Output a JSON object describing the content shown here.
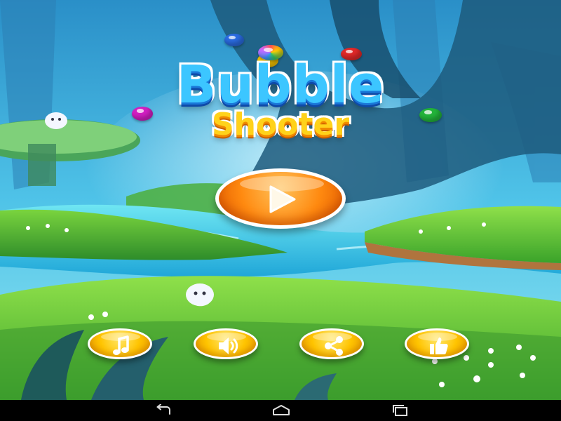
{
  "game": {
    "title_main": "Bubble",
    "title_sub": "Shooter"
  },
  "buttons": {
    "play": {
      "icon": "play-icon"
    },
    "music": {
      "icon": "music-note-icon"
    },
    "sound": {
      "icon": "speaker-icon"
    },
    "share": {
      "icon": "share-icon"
    },
    "like": {
      "icon": "thumbs-up-icon"
    }
  },
  "navigation_bar": {
    "back": {
      "icon": "back-icon"
    },
    "home": {
      "icon": "home-icon"
    },
    "recents": {
      "icon": "recent-apps-icon"
    }
  },
  "colors": {
    "title_blue": "#3cc6ff",
    "title_yellow": "#ffd21a",
    "play_orange": "#ff8a10",
    "button_yellow": "#ffc400",
    "grass": "#58c03a",
    "river": "#3fd0e8"
  }
}
